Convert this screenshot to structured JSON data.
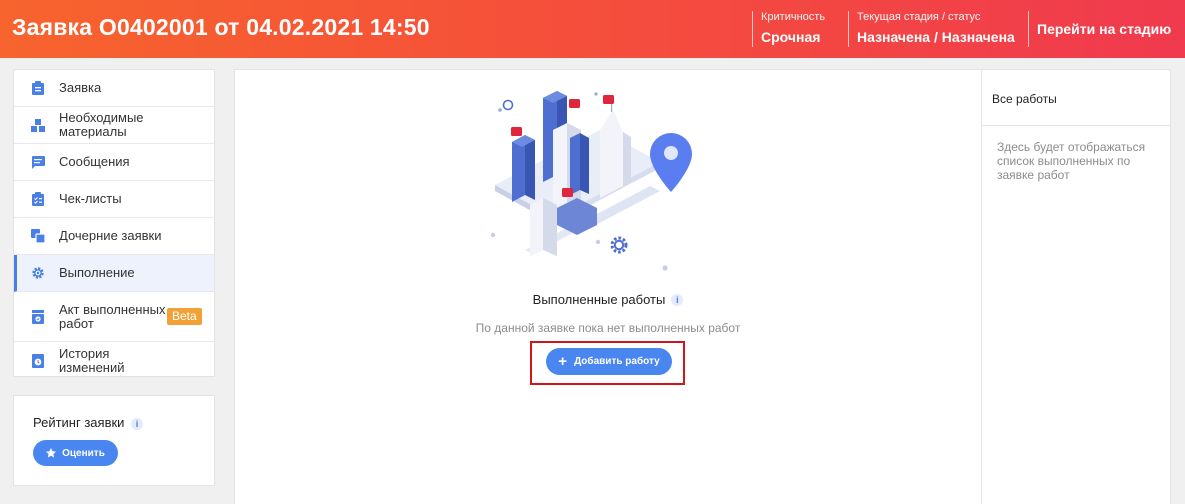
{
  "header": {
    "title": "Заявка O0402001 от 04.02.2021 14:50",
    "criticality_label": "Критичность",
    "criticality_value": "Срочная",
    "stage_label": "Текущая стадия / статус",
    "stage_value": "Назначена / Назначена",
    "goto_stage": "Перейти на стадию",
    "gradient": [
      "#f7642d",
      "#f03a4e"
    ]
  },
  "sidebar": {
    "items": [
      {
        "label": "Заявка",
        "icon": "clipboard-icon"
      },
      {
        "label": "Необходимые материалы",
        "icon": "boxes-icon"
      },
      {
        "label": "Сообщения",
        "icon": "chat-icon"
      },
      {
        "label": "Чек-листы",
        "icon": "checklist-icon"
      },
      {
        "label": "Дочерние заявки",
        "icon": "child-requests-icon"
      },
      {
        "label": "Выполнение",
        "icon": "gear-icon",
        "active": true
      },
      {
        "label": "Акт выполненных работ",
        "icon": "act-icon",
        "badge": "Beta"
      },
      {
        "label": "История изменений",
        "icon": "history-icon"
      }
    ],
    "accent": "#4a7fe6"
  },
  "rating": {
    "title": "Рейтинг заявки",
    "info": "i",
    "button": "Оценить"
  },
  "main": {
    "section_title": "Выполненные работы",
    "info": "i",
    "empty_text": "По данной заявке пока нет выполненных работ",
    "add_button": "Добавить работу",
    "highlight_color": "#d4141b"
  },
  "side": {
    "title": "Все работы",
    "empty_text": "Здесь будет отображаться список выполненных по заявке работ"
  }
}
